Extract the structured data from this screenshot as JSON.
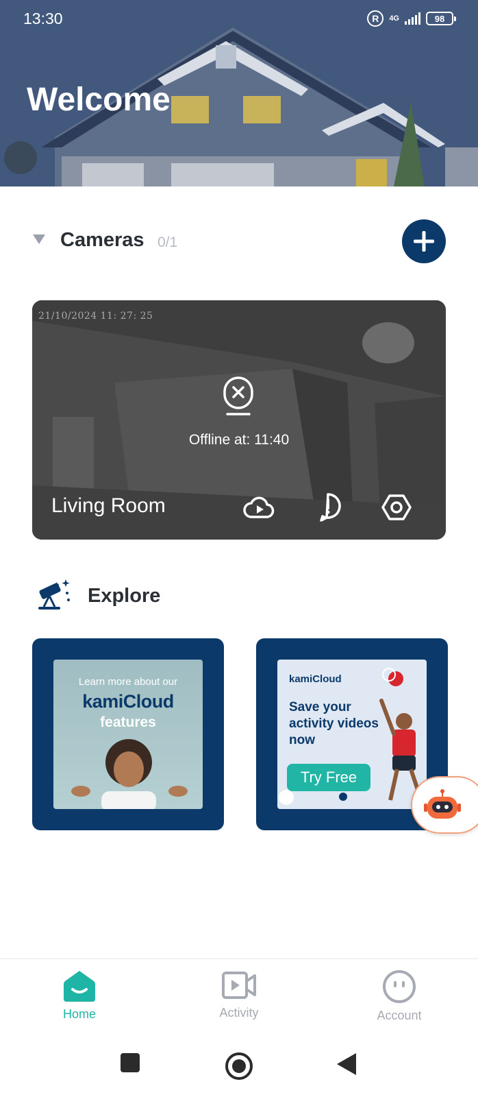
{
  "status_bar": {
    "time": "13:30",
    "registered_badge": "R",
    "network": "4G",
    "battery": "98"
  },
  "header": {
    "title": "Welcome"
  },
  "cameras": {
    "title": "Cameras",
    "count": "0/1",
    "card": {
      "timestamp": "21/10/2024  11: 27: 25",
      "status_text": "Offline at: 11:40",
      "name": "Living Room",
      "actions": [
        "cloud-playback-icon",
        "alert-icon",
        "settings-icon"
      ]
    }
  },
  "explore": {
    "title": "Explore",
    "promos": [
      {
        "line1": "Learn more about our",
        "brand": "kamiCloud",
        "line3": "features"
      },
      {
        "brand": "kamiCloud",
        "headline": "Save your activity videos now",
        "button": "Try Free"
      }
    ]
  },
  "bottom_nav": {
    "items": [
      {
        "label": "Home",
        "active": true
      },
      {
        "label": "Activity",
        "active": false
      },
      {
        "label": "Account",
        "active": false
      }
    ]
  },
  "colors": {
    "brand_navy": "#0b3a6a",
    "accent_teal": "#1fb5a6"
  }
}
